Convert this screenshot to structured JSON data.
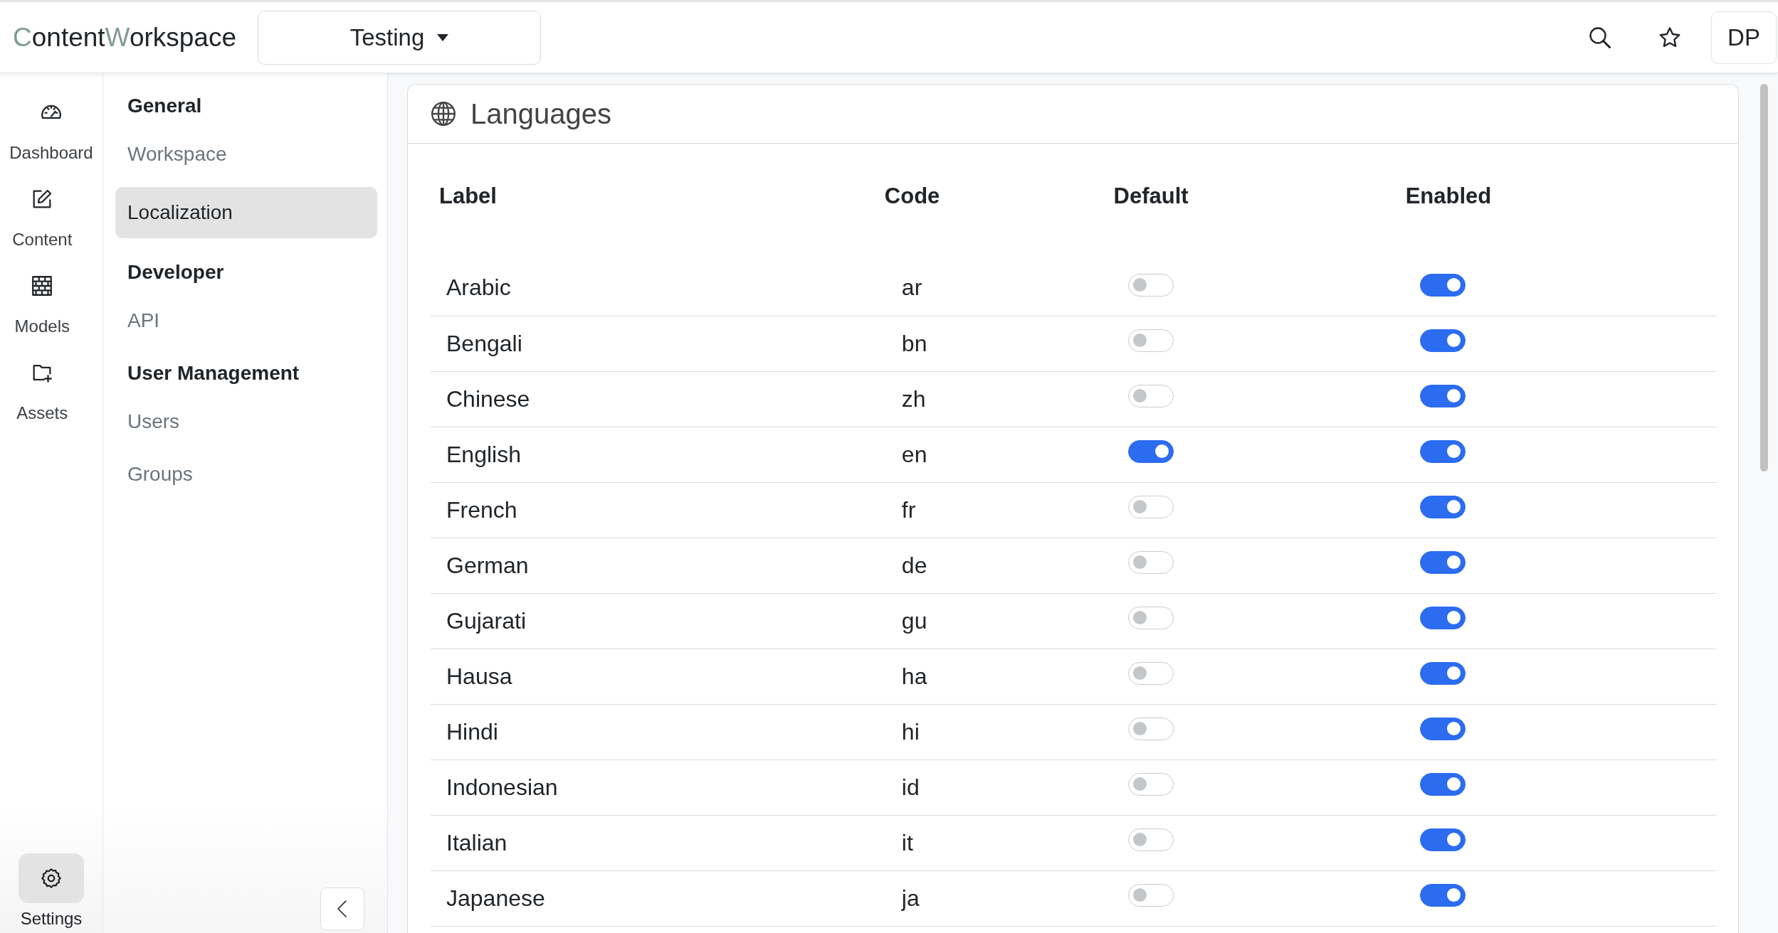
{
  "header": {
    "logo": [
      {
        "text": "C",
        "accent": true
      },
      {
        "text": "ontent",
        "accent": false
      },
      {
        "text": "W",
        "accent": true
      },
      {
        "text": "orkspace",
        "accent": false
      }
    ],
    "workspace_select": "Testing",
    "avatar": "DP"
  },
  "rail": {
    "items": [
      {
        "label": "Dashboard",
        "selected": false
      },
      {
        "label": "Content",
        "selected": false
      },
      {
        "label": "Models",
        "selected": false
      },
      {
        "label": "Assets",
        "selected": false
      }
    ],
    "footer": {
      "label": "Settings",
      "selected": true
    }
  },
  "nav": {
    "sections": [
      {
        "title": "General",
        "items": [
          {
            "label": "Workspace",
            "selected": false
          },
          {
            "label": "Localization",
            "selected": true
          }
        ]
      },
      {
        "title": "Developer",
        "items": [
          {
            "label": "API",
            "selected": false
          }
        ]
      },
      {
        "title": "User Management",
        "items": [
          {
            "label": "Users",
            "selected": false
          },
          {
            "label": "Groups",
            "selected": false
          }
        ]
      }
    ]
  },
  "languages": {
    "title": "Languages",
    "columns": [
      "Label",
      "Code",
      "Default",
      "Enabled"
    ],
    "rows": [
      {
        "label": "Arabic",
        "code": "ar",
        "default": false,
        "enabled": true
      },
      {
        "label": "Bengali",
        "code": "bn",
        "default": false,
        "enabled": true
      },
      {
        "label": "Chinese",
        "code": "zh",
        "default": false,
        "enabled": true
      },
      {
        "label": "English",
        "code": "en",
        "default": true,
        "enabled": true
      },
      {
        "label": "French",
        "code": "fr",
        "default": false,
        "enabled": true
      },
      {
        "label": "German",
        "code": "de",
        "default": false,
        "enabled": true
      },
      {
        "label": "Gujarati",
        "code": "gu",
        "default": false,
        "enabled": true
      },
      {
        "label": "Hausa",
        "code": "ha",
        "default": false,
        "enabled": true
      },
      {
        "label": "Hindi",
        "code": "hi",
        "default": false,
        "enabled": true
      },
      {
        "label": "Indonesian",
        "code": "id",
        "default": false,
        "enabled": true
      },
      {
        "label": "Italian",
        "code": "it",
        "default": false,
        "enabled": true
      },
      {
        "label": "Japanese",
        "code": "ja",
        "default": false,
        "enabled": true
      }
    ]
  }
}
